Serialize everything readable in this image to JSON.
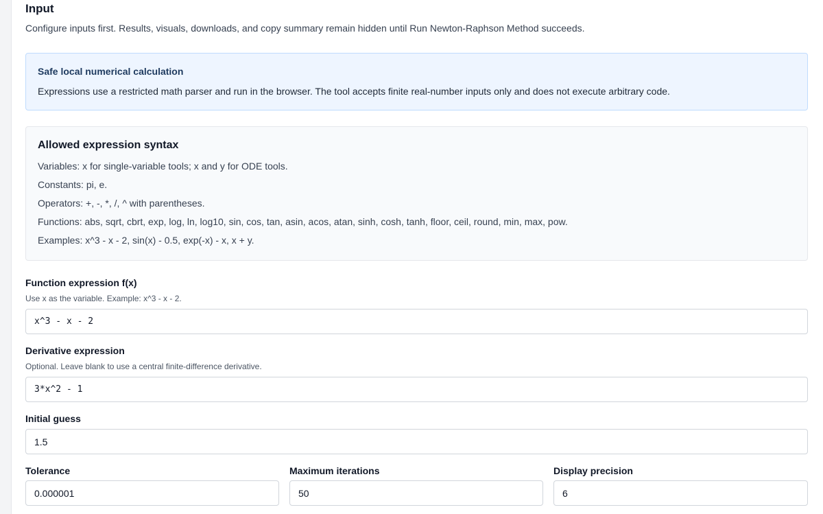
{
  "section": {
    "title": "Input",
    "intro": "Configure inputs first. Results, visuals, downloads, and copy summary remain hidden until Run Newton-Raphson Method succeeds."
  },
  "notice": {
    "title": "Safe local numerical calculation",
    "text": "Expressions use a restricted math parser and run in the browser. The tool accepts finite real-number inputs only and does not execute arbitrary code."
  },
  "syntax": {
    "title": "Allowed expression syntax",
    "items": [
      "Variables: x for single-variable tools; x and y for ODE tools.",
      "Constants: pi, e.",
      "Operators: +, -, *, /, ^ with parentheses.",
      "Functions: abs, sqrt, cbrt, exp, log, ln, log10, sin, cos, tan, asin, acos, atan, sinh, cosh, tanh, floor, ceil, round, min, max, pow.",
      "Examples: x^3 - x - 2, sin(x) - 0.5, exp(-x) - x, x + y."
    ]
  },
  "fields": {
    "function": {
      "label": "Function expression f(x)",
      "hint": "Use x as the variable. Example: x^3 - x - 2.",
      "value": "x^3 - x - 2"
    },
    "derivative": {
      "label": "Derivative expression",
      "hint": "Optional. Leave blank to use a central finite-difference derivative.",
      "value": "3*x^2 - 1"
    },
    "initial_guess": {
      "label": "Initial guess",
      "value": "1.5"
    },
    "tolerance": {
      "label": "Tolerance",
      "value": "0.000001"
    },
    "max_iterations": {
      "label": "Maximum iterations",
      "value": "50"
    },
    "precision": {
      "label": "Display precision",
      "value": "6"
    }
  }
}
